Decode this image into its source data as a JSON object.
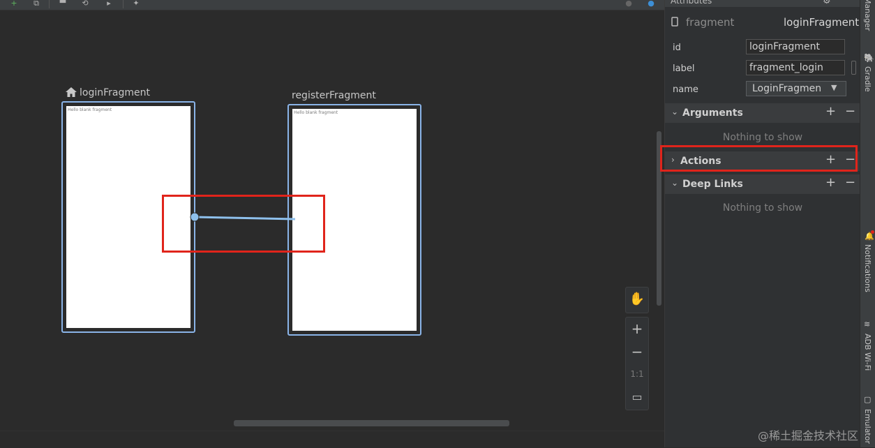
{
  "toolbar": {
    "icons": [
      "add-destination-icon",
      "new-fragment-icon",
      "home-icon",
      "nested-graph-icon",
      "run-icon",
      "auto-arrange-icon",
      "warning-icon",
      "info-icon"
    ]
  },
  "canvas": {
    "fragments": [
      {
        "title": "loginFragment",
        "hint": "Hello blank fragment",
        "is_start": true
      },
      {
        "title": "registerFragment",
        "hint": "Hello blank fragment",
        "is_start": false
      }
    ],
    "zoom": {
      "hand": "✋",
      "zoom_in": "+",
      "zoom_out": "−",
      "actual_size": "1:1",
      "fit": "▭"
    }
  },
  "attributes": {
    "panel_title": "Attributes",
    "type_label": "fragment",
    "type_value": "loginFragment",
    "id_label": "id",
    "id_value": "loginFragment",
    "label_label": "label",
    "label_value": "fragment_login",
    "name_label": "name",
    "name_value": "LoginFragmen",
    "sections": [
      {
        "title": "Arguments",
        "expanded": true,
        "empty_text": "Nothing to show"
      },
      {
        "title": "Actions",
        "expanded": false,
        "empty_text": ""
      },
      {
        "title": "Deep Links",
        "expanded": true,
        "empty_text": "Nothing to show"
      }
    ]
  },
  "right_strip": {
    "tabs": [
      "Manager",
      "Gradle",
      "Notifications",
      "ADB Wi-Fi",
      "Emulator"
    ]
  },
  "watermark": "@稀土掘金技术社区",
  "colors": {
    "canvas_bg": "#2b2b2b",
    "panel_bg": "#2f3133",
    "fragment_border": "#8ab4e8",
    "highlight": "#e0241b"
  }
}
